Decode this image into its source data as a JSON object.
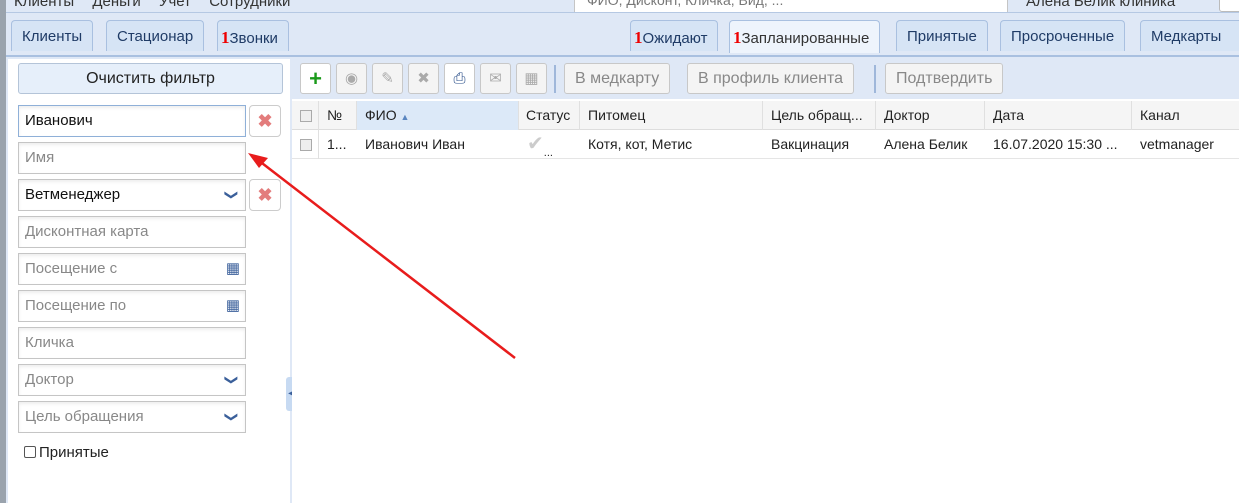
{
  "topbar": {
    "menu": [
      "Клиенты",
      "Деньги",
      "Учет",
      "Сотрудники"
    ],
    "search_placeholder": "ФИО, Дисконт, Кличка, Вид, ...",
    "user": "Алена Белик клиника"
  },
  "tabs_left": [
    {
      "label": "Клиенты"
    },
    {
      "label": "Стационар"
    },
    {
      "label": "Звонки",
      "badge": "1"
    }
  ],
  "tabs_right": [
    {
      "label": "Ожидают",
      "badge": "1"
    },
    {
      "label": "Запланированные",
      "badge": "1"
    },
    {
      "label": "Принятые"
    },
    {
      "label": "Просроченные"
    },
    {
      "label": "Медкарты"
    }
  ],
  "filter": {
    "clear_label": "Очистить фильтр",
    "surname_value": "Иванович",
    "name_placeholder": "Имя",
    "source_value": "Ветменеджер",
    "discount_placeholder": "Дисконтная карта",
    "visit_from_placeholder": "Посещение с",
    "visit_to_placeholder": "Посещение по",
    "nickname_placeholder": "Кличка",
    "doctor_placeholder": "Доктор",
    "purpose_placeholder": "Цель обращения",
    "accepted_label": "Принятые"
  },
  "toolbar": {
    "to_medcard": "В медкарту",
    "to_profile": "В профиль клиента",
    "confirm": "Подтвердить"
  },
  "colors": {
    "accent": "#dfe8f6",
    "badge": "#ee0000",
    "add": "#1a9a1a"
  },
  "table": {
    "columns": [
      "№",
      "ФИО",
      "Статус",
      "Питомец",
      "Цель обращ...",
      "Доктор",
      "Дата",
      "Канал"
    ],
    "rows": [
      {
        "num": "1...",
        "fio": "Иванович Иван",
        "status": "...",
        "pet": "Котя, кот, Метис",
        "purpose": "Вакцинация",
        "doctor": "Алена Белик",
        "date": "16.07.2020 15:30 ...",
        "channel": "vetmanager"
      }
    ]
  }
}
